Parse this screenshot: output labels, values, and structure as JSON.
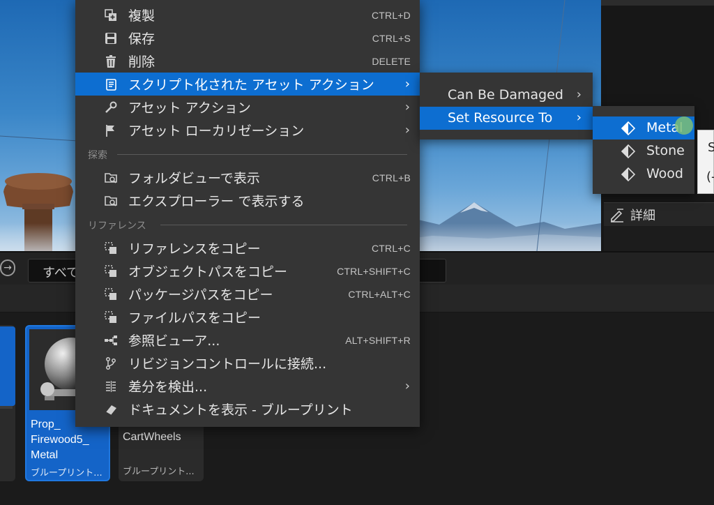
{
  "context_menu": {
    "items": [
      {
        "label": "複製",
        "shortcut": "CTRL+D",
        "icon": "duplicate-icon"
      },
      {
        "label": "保存",
        "shortcut": "CTRL+S",
        "icon": "save-icon"
      },
      {
        "label": "削除",
        "shortcut": "DELETE",
        "icon": "delete-icon"
      },
      {
        "label": "スクリプト化された アセット アクション",
        "icon": "scroll-icon",
        "highlighted": true,
        "submenu": true
      },
      {
        "label": "アセット アクション",
        "icon": "wrench-icon",
        "submenu": true
      },
      {
        "label": "アセット ローカリゼーション",
        "icon": "flag-icon",
        "submenu": true
      }
    ],
    "section_explore": "探索",
    "explore_items": [
      {
        "label": "フォルダビューで表示",
        "shortcut": "CTRL+B",
        "icon": "folder-search-icon"
      },
      {
        "label": "エクスプローラー で表示する",
        "icon": "folder-search-icon"
      }
    ],
    "section_reference": "リファレンス",
    "reference_items": [
      {
        "label": "リファレンスをコピー",
        "shortcut": "CTRL+C",
        "icon": "copy-icon"
      },
      {
        "label": "オブジェクトパスをコピー",
        "shortcut": "CTRL+SHIFT+C",
        "icon": "copy-icon"
      },
      {
        "label": "パッケージパスをコピー",
        "shortcut": "CTRL+ALT+C",
        "icon": "copy-icon"
      },
      {
        "label": "ファイルパスをコピー",
        "icon": "copy-icon"
      },
      {
        "label": "参照ビューア...",
        "shortcut": "ALT+SHIFT+R",
        "icon": "reference-viewer-icon"
      },
      {
        "label": "リビジョンコントロールに接続...",
        "icon": "branch-icon"
      },
      {
        "label": "差分を検出...",
        "icon": "diff-icon",
        "submenu": true
      },
      {
        "label": "ドキュメントを表示 - ブループリント",
        "icon": "book-icon"
      }
    ]
  },
  "submenu_scripted": {
    "items": [
      {
        "label": "Can Be Damaged"
      },
      {
        "label": "Set Resource To",
        "highlighted": true
      }
    ]
  },
  "submenu_resource": {
    "items": [
      {
        "label": "Metal",
        "highlighted": true
      },
      {
        "label": "Stone"
      },
      {
        "label": "Wood"
      }
    ]
  },
  "tooltip": {
    "line1": "S",
    "line2": "(-"
  },
  "details_panel": {
    "title": "詳細",
    "icon": "pencil-icon"
  },
  "content_browser": {
    "search_value": "すべて",
    "assets": [
      {
        "name": "Prop_ Firewood5_ Metal",
        "type": "ブループリント...",
        "selected": true
      },
      {
        "name": "CartWheels",
        "type": "ブループリント...",
        "selected": false
      }
    ]
  },
  "colors": {
    "menu_bg": "#353535",
    "highlight": "#0d6ed1",
    "selection": "#1464c8"
  }
}
